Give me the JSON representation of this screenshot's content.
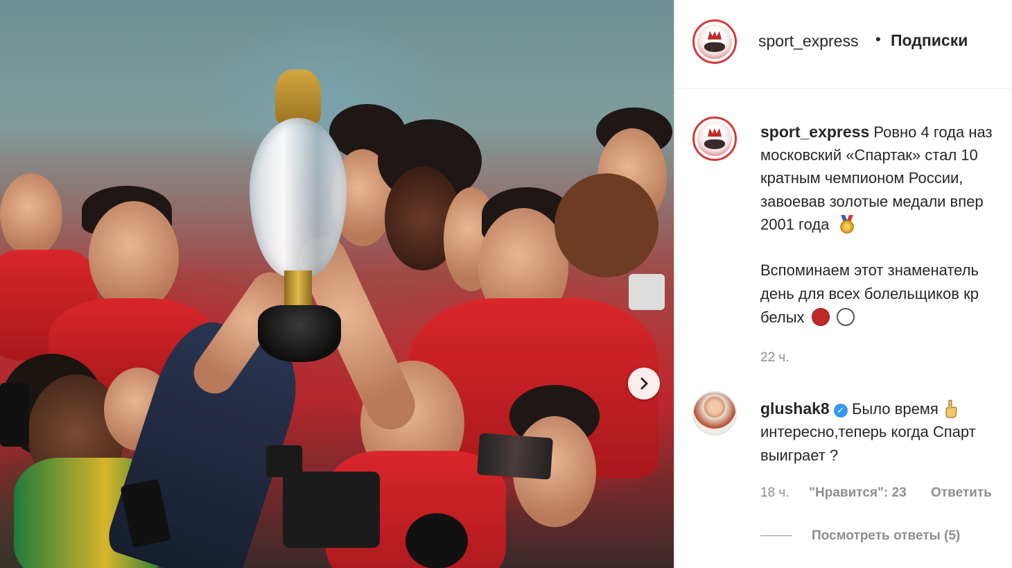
{
  "post": {
    "author": "sport_express",
    "follow_separator": "•",
    "follow_label": "Подписки",
    "caption": {
      "line1": "Ровно 4 года наз",
      "line2": "московский «Спартак» стал 10",
      "line3": "кратным чемпионом России,",
      "line4": "завоевав золотые медали впер",
      "line5": "2001 года",
      "line7": "Вспоминаем этот знаменатель",
      "line8": "день для всех болельщиков кр",
      "line9": "белых"
    },
    "time": "22 ч.",
    "colors": {
      "red_dot": "#c0282b",
      "white_dot": "#ffffff",
      "accent": "#3897f0"
    }
  },
  "comment": {
    "author": "glushak8",
    "line1": "Было время",
    "line2": "интересно,теперь когда Спарт",
    "line3": "выиграет ?",
    "time": "18 ч.",
    "likes": "\"Нравится\": 23",
    "reply": "Ответить",
    "view_replies": "Посмотреть ответы (5)"
  },
  "icons": {
    "next": "chevron-right-icon",
    "medal": "medal-icon",
    "hand": "hand-icon",
    "verified": "verified-badge-icon"
  }
}
